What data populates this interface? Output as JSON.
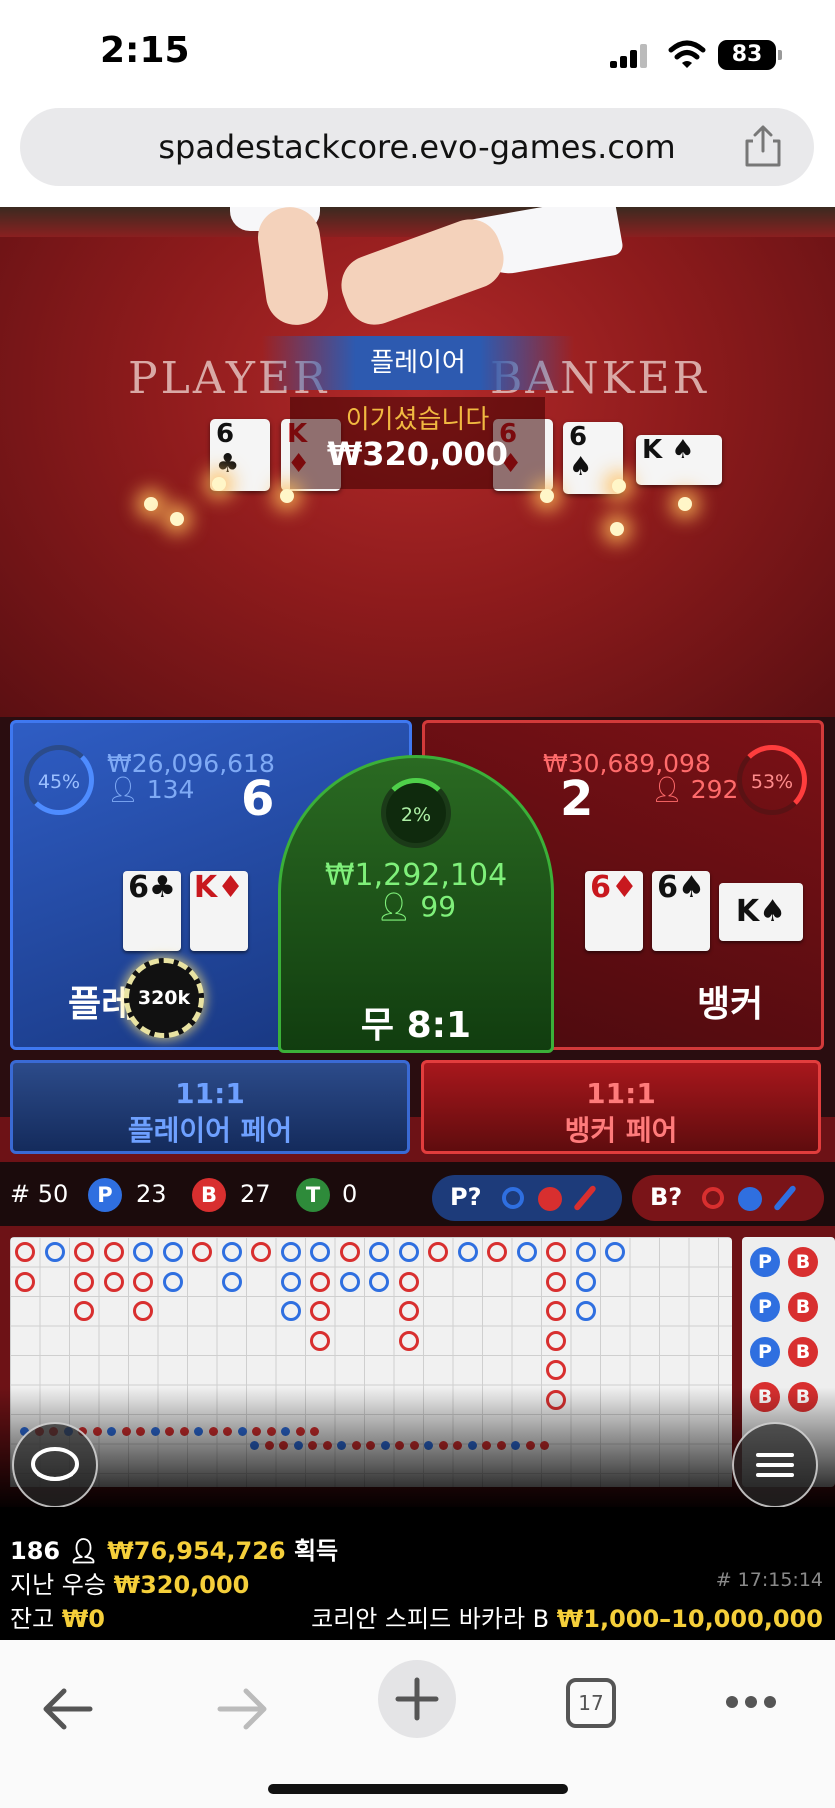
{
  "status_bar": {
    "time": "2:15",
    "battery": "83"
  },
  "browser": {
    "url": "spadestackcore.evo-games.com",
    "tab_count": "17"
  },
  "table": {
    "player_word": "PLAYER",
    "banker_word": "BANKER",
    "result_banner": "플레이어",
    "win_label": "이기셨습니다",
    "win_amount": "₩320,000",
    "player_cards": [
      {
        "rank": "6",
        "suit": "♣",
        "color": "black"
      },
      {
        "rank": "K",
        "suit": "♦",
        "color": "red"
      }
    ],
    "banker_cards": [
      {
        "rank": "6",
        "suit": "♦",
        "color": "red"
      },
      {
        "rank": "6",
        "suit": "♠",
        "color": "black"
      },
      {
        "rank": "K",
        "suit": "♠",
        "color": "black"
      }
    ]
  },
  "betting": {
    "player": {
      "percent": "45%",
      "amount": "₩26,096,618",
      "players": "134",
      "total": "6",
      "label": "플레이어",
      "cards": [
        "6♣",
        "K♦"
      ],
      "chip": "320k"
    },
    "tie": {
      "percent": "2%",
      "amount": "₩1,292,104",
      "players": "99",
      "label": "무 8:1"
    },
    "banker": {
      "percent": "53%",
      "amount": "₩30,689,098",
      "players": "292",
      "total": "2",
      "label": "뱅커",
      "cards": [
        "6♦",
        "6♠",
        "K♠"
      ]
    },
    "player_pair": {
      "odds": "11:1",
      "label": "플레이어 페어"
    },
    "banker_pair": {
      "odds": "11:1",
      "label": "뱅커 페어"
    }
  },
  "stats": {
    "rounds": "# 50",
    "p_label": "P",
    "p_count": "23",
    "b_label": "B",
    "b_count": "27",
    "t_label": "T",
    "t_count": "0",
    "player_predict": "P?",
    "banker_predict": "B?"
  },
  "side_road": [
    "P",
    "B",
    "P",
    "B",
    "P",
    "B",
    "B",
    "B"
  ],
  "footer": {
    "online": "186",
    "total_win": "₩76,954,726",
    "total_win_suffix": "획득",
    "last_win_label": "지난 우승",
    "last_win": "₩320,000",
    "round_id": "# 17:15:14",
    "balance_label": "잔고",
    "balance": "₩0",
    "table_name": "코리안 스피드 바카라 B",
    "limits": "₩1,000–10,000,000"
  },
  "colors": {
    "player_blue": "#2f6fe0",
    "banker_red": "#d82f2f",
    "tie_green": "#3bb039",
    "gold": "#f5cf3a"
  }
}
